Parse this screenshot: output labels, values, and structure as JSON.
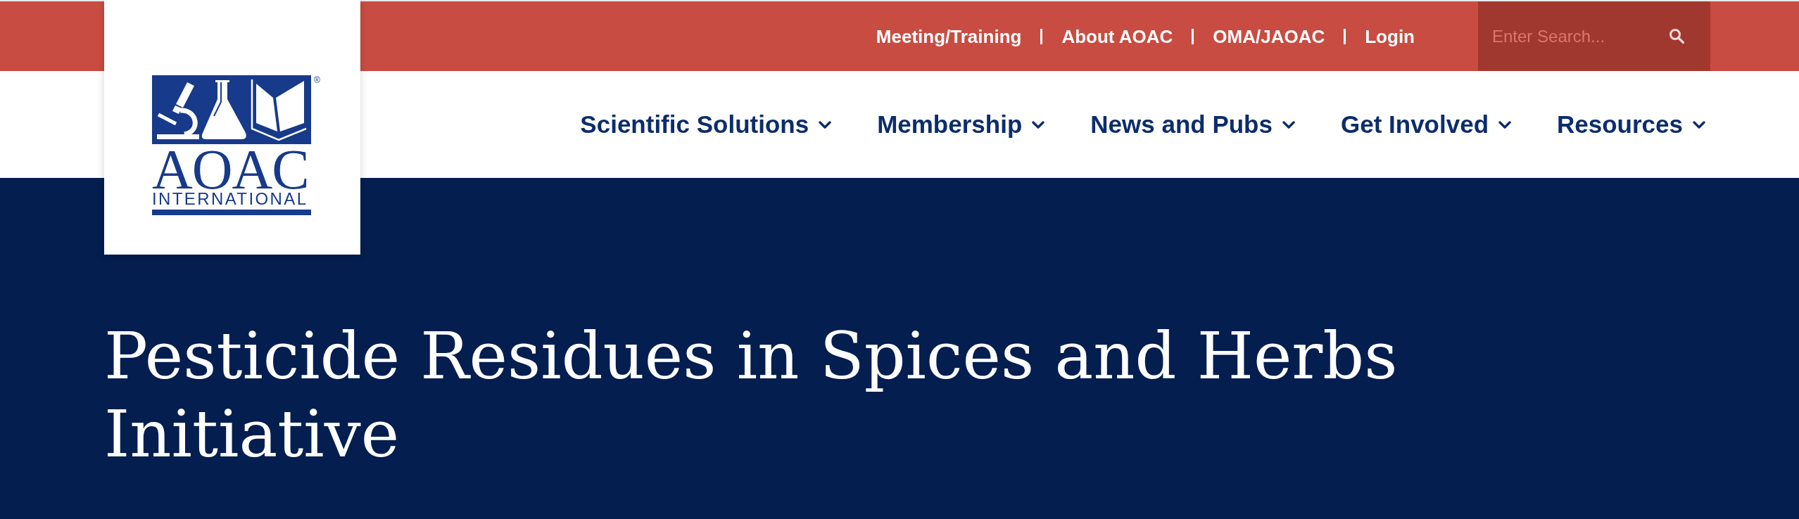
{
  "logo": {
    "wordmark": "AOAC",
    "subtitle": "INTERNATIONAL",
    "registered_mark": "®"
  },
  "top_links": [
    {
      "label": "Meeting/Training"
    },
    {
      "label": "About AOAC"
    },
    {
      "label": "OMA/JAOAC"
    },
    {
      "label": "Login"
    }
  ],
  "search": {
    "placeholder": "Enter Search..."
  },
  "main_nav": [
    {
      "label": "Scientific Solutions"
    },
    {
      "label": "Membership"
    },
    {
      "label": "News and Pubs"
    },
    {
      "label": "Get Involved"
    },
    {
      "label": "Resources"
    }
  ],
  "hero": {
    "title": "Pesticide Residues in Spices and Herbs Initiative"
  }
}
